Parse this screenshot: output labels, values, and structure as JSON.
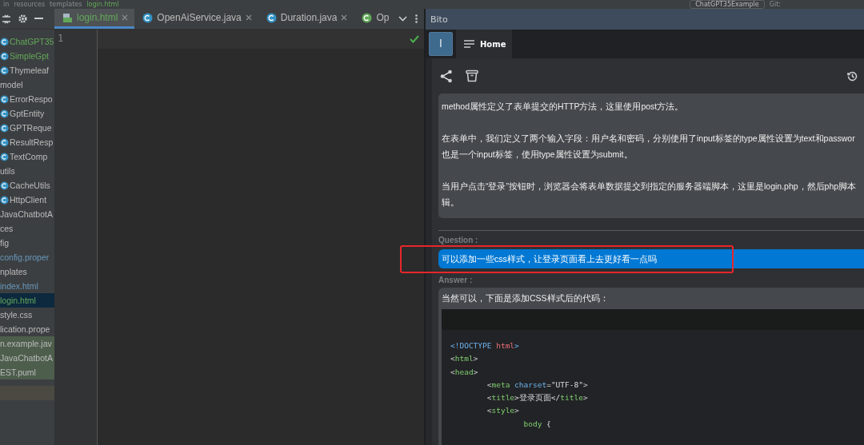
{
  "breadcrumb": [
    "in",
    "resources",
    "templates",
    "login.html"
  ],
  "run_config": "ChatGPT35Example",
  "vcs_label": "Git:",
  "project_tree": [
    {
      "label": "ChatGPT35",
      "kind": "class",
      "color": "#62a85a",
      "selected": false,
      "highlighted": false
    },
    {
      "label": "SimpleGpt",
      "kind": "class",
      "color": "#62a85a",
      "selected": false,
      "highlighted": false
    },
    {
      "label": "Thymeleaf",
      "kind": "class",
      "selected": false,
      "highlighted": false
    },
    {
      "label": "model",
      "kind": "folder",
      "selected": false,
      "highlighted": false
    },
    {
      "label": "ErrorRespo",
      "kind": "class",
      "selected": false,
      "highlighted": false
    },
    {
      "label": "GptEntity",
      "kind": "class",
      "selected": false,
      "highlighted": false
    },
    {
      "label": "GPTReque",
      "kind": "class",
      "selected": false,
      "highlighted": false
    },
    {
      "label": "ResultResp",
      "kind": "class",
      "selected": false,
      "highlighted": false
    },
    {
      "label": "TextComp",
      "kind": "class",
      "selected": false,
      "highlighted": false
    },
    {
      "label": "utils",
      "kind": "folder",
      "selected": false,
      "highlighted": false
    },
    {
      "label": "CacheUtils",
      "kind": "class",
      "selected": false,
      "highlighted": false
    },
    {
      "label": "HttpClient",
      "kind": "class",
      "selected": false,
      "highlighted": false
    },
    {
      "label": "JavaChatbotA",
      "kind": "folder",
      "selected": false,
      "highlighted": false
    },
    {
      "label": "ces",
      "kind": "folder",
      "selected": false,
      "highlighted": false
    },
    {
      "label": "fig",
      "kind": "folder",
      "selected": false,
      "highlighted": false
    },
    {
      "label": "config.proper",
      "kind": "file",
      "color": "#6897bb",
      "selected": false,
      "highlighted": false
    },
    {
      "label": "nplates",
      "kind": "folder",
      "selected": false,
      "highlighted": false
    },
    {
      "label": "index.html",
      "kind": "file",
      "color": "#6897bb",
      "selected": false,
      "highlighted": false
    },
    {
      "label": "login.html",
      "kind": "file",
      "color": "#62a85a",
      "selected": true,
      "highlighted": false
    },
    {
      "label": "style.css",
      "kind": "file",
      "selected": false,
      "highlighted": false
    },
    {
      "label": "lication.prope",
      "kind": "file",
      "selected": false,
      "highlighted": false
    },
    {
      "label": "n.example.jav",
      "kind": "file",
      "selected": false,
      "highlighted": true
    },
    {
      "label": "JavaChatbotA",
      "kind": "file",
      "selected": false,
      "highlighted": true
    },
    {
      "label": "EST.puml",
      "kind": "file",
      "selected": false,
      "highlighted": true
    }
  ],
  "editor_tabs": [
    {
      "label": "login.html",
      "kind": "html",
      "selected": true,
      "closable": true
    },
    {
      "label": "OpenAiService.java",
      "kind": "class",
      "selected": false,
      "closable": true
    },
    {
      "label": "Duration.java",
      "kind": "class",
      "selected": false,
      "closable": true
    },
    {
      "label": "Op",
      "kind": "interface",
      "selected": false,
      "closable": false
    }
  ],
  "line_numbers": [
    "1"
  ],
  "bito": {
    "title": "Bito",
    "avatar": "l",
    "home_tab": "Home",
    "previous_answer": [
      [
        "method属性定义了表单提交的HTTP方法，这里使用post方法。"
      ],
      [
        "在表单中，我们定义了两个输入字段：用户名和密码，分别使用了input标签的type属性设置为text和passwor",
        "也是一个input标签，使用type属性设置为submit。"
      ],
      [
        "当用户点击“登录”按钮时，浏览器会将表单数据提交到指定的服务器端脚本，这里是login.php，然后php脚本",
        "辑。"
      ]
    ],
    "question_label": "Question :",
    "question": "可以添加一些css样式，让登录页面看上去更好看一点吗",
    "answer_label": "Answer :",
    "answer_intro": "当然可以，下面是添加CSS样式后的代码：",
    "code_lines": [
      [
        {
          "text": "<!DOCTYPE ",
          "kind": "keyword"
        },
        {
          "text": "html",
          "kind": "attr-value"
        },
        {
          "text": ">",
          "kind": "keyword"
        }
      ],
      [
        {
          "text": "<",
          "kind": "punct"
        },
        {
          "text": "html",
          "kind": "tag"
        },
        {
          "text": ">",
          "kind": "punct"
        }
      ],
      [
        {
          "text": "<",
          "kind": "punct"
        },
        {
          "text": "head",
          "kind": "tag"
        },
        {
          "text": ">",
          "kind": "punct"
        }
      ],
      [
        {
          "text": "        <",
          "kind": "punct"
        },
        {
          "text": "meta ",
          "kind": "tag"
        },
        {
          "text": "charset",
          "kind": "keyword"
        },
        {
          "text": "=",
          "kind": "punct"
        },
        {
          "text": "\"UTF-8\"",
          "kind": "plain"
        },
        {
          "text": ">",
          "kind": "punct"
        }
      ],
      [
        {
          "text": "        <",
          "kind": "punct"
        },
        {
          "text": "title",
          "kind": "tag"
        },
        {
          "text": ">登录页面</",
          "kind": "plain"
        },
        {
          "text": "title",
          "kind": "tag"
        },
        {
          "text": ">",
          "kind": "punct"
        }
      ],
      [
        {
          "text": "        <",
          "kind": "punct"
        },
        {
          "text": "style",
          "kind": "tag"
        },
        {
          "text": ">",
          "kind": "punct"
        }
      ],
      [
        {
          "text": "                body ",
          "kind": "tag"
        },
        {
          "text": "{",
          "kind": "plain"
        }
      ]
    ]
  }
}
